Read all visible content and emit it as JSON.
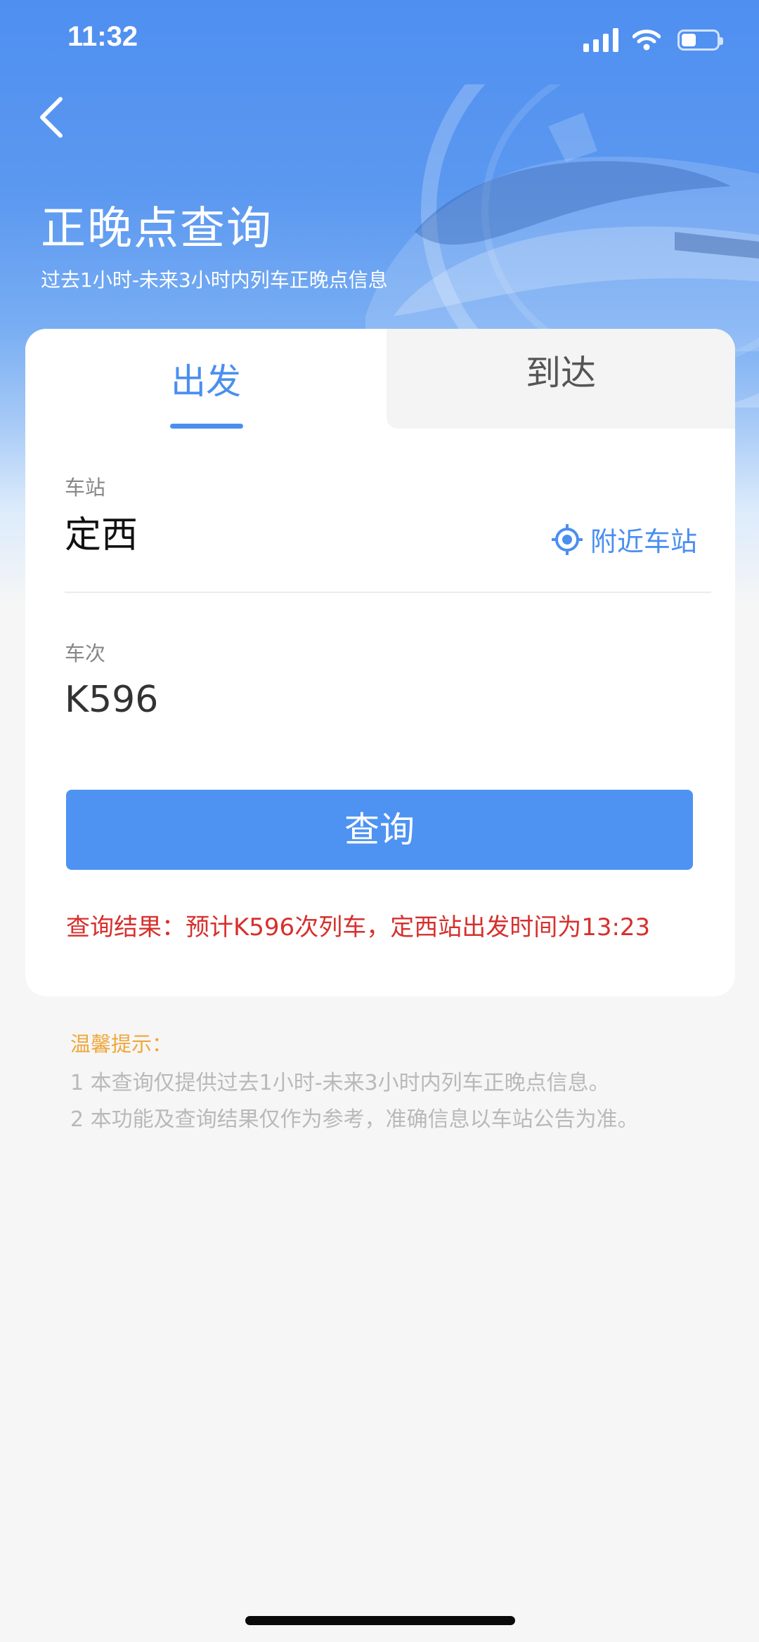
{
  "status_bar": {
    "time": "11:32"
  },
  "header": {
    "title": "正晚点查询",
    "subtitle": "过去1小时-未来3小时内列车正晚点信息"
  },
  "tabs": [
    {
      "label": "出发",
      "selected": true
    },
    {
      "label": "到达",
      "selected": false
    }
  ],
  "form": {
    "station_label": "车站",
    "station_value": "定西",
    "nearby_label": "附近车站",
    "train_label": "车次",
    "train_value": "K596",
    "query_label": "查询"
  },
  "result": {
    "text": "查询结果：预计K596次列车，定西站出发时间为13:23"
  },
  "tips": {
    "title": "温馨提示：",
    "lines": [
      "1 本查询仅提供过去1小时-未来3小时内列车正晚点信息。",
      "2 本功能及查询结果仅作为参考，准确信息以车站公告为准。"
    ]
  },
  "colors": {
    "accent": "#4a8ff0",
    "result_red": "#d6302d",
    "tip_orange": "#f0a73a"
  }
}
